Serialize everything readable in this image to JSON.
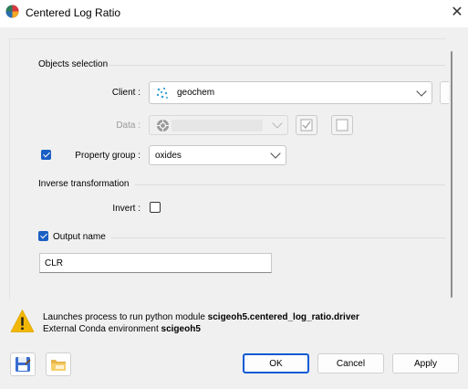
{
  "window": {
    "title": "Centered Log Ratio"
  },
  "objects_selection": {
    "title": "Objects selection",
    "client_label": "Client :",
    "client_value": "geochem",
    "data_label": "Data :",
    "property_group_label": "Property group :",
    "property_group_value": "oxides",
    "property_group_checked": true
  },
  "inverse_transformation": {
    "title": "Inverse transformation",
    "invert_label": "Invert :",
    "invert_checked": false
  },
  "output": {
    "title": "Output name",
    "checked": true,
    "value": "CLR"
  },
  "message": {
    "line1_prefix": "Launches process to run python module ",
    "line1_module": "scigeoh5.centered_log_ratio.driver",
    "line2_prefix": "External Conda environment ",
    "line2_env": "scigeoh5"
  },
  "buttons": {
    "ok": "OK",
    "cancel": "Cancel",
    "apply": "Apply"
  },
  "colors": {
    "accent": "#1a5fc4",
    "warning": "#f2b705"
  }
}
